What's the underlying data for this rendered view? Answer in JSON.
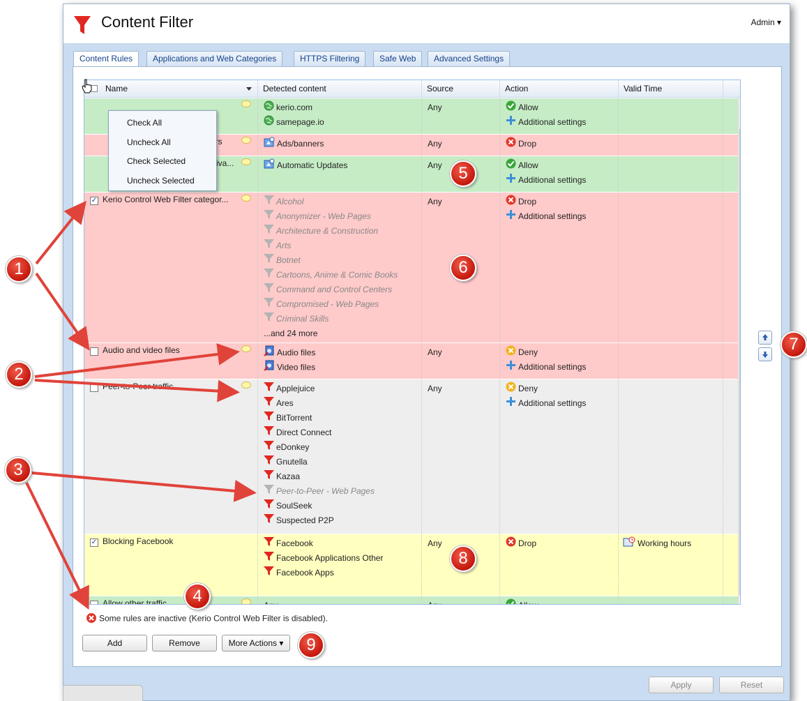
{
  "window": {
    "title": "Content Filter",
    "user_menu": "Admin ▾",
    "brand_color": "#e02820"
  },
  "tabs": [
    {
      "label": "Content Rules",
      "active": true
    },
    {
      "label": "Applications and Web Categories",
      "active": false
    },
    {
      "label": "HTTPS Filtering",
      "active": false
    },
    {
      "label": "Safe Web",
      "active": false
    },
    {
      "label": "Advanced Settings",
      "active": false
    }
  ],
  "grid": {
    "columns": [
      "Name",
      "Detected content",
      "Source",
      "Action",
      "Valid Time"
    ],
    "header_menu": [
      "Check All",
      "Uncheck All",
      "Check Selected",
      "Uncheck Selected"
    ],
    "rows": [
      {
        "name": "",
        "checked": false,
        "color": "green",
        "detected": [
          {
            "text": "kerio.com",
            "icon": "globe-icon"
          },
          {
            "text": "samepage.io",
            "icon": "globe-icon"
          }
        ],
        "source": "Any",
        "action": [
          {
            "text": "Allow",
            "icon": "allow-icon"
          },
          {
            "text": "Additional settings",
            "icon": "plus-icon"
          }
        ],
        "valid_time": ""
      },
      {
        "name": "ers",
        "checked": false,
        "color": "red",
        "detected": [
          {
            "text": "Ads/banners",
            "icon": "app-category-icon"
          }
        ],
        "source": "Any",
        "action": [
          {
            "text": "Drop",
            "icon": "drop-icon"
          }
        ],
        "valid_time": ""
      },
      {
        "name": "activa...",
        "checked": false,
        "color": "green",
        "detected": [
          {
            "text": "Automatic Updates",
            "icon": "app-category-icon"
          }
        ],
        "source": "Any",
        "action": [
          {
            "text": "Allow",
            "icon": "allow-icon"
          },
          {
            "text": "Additional settings",
            "icon": "plus-icon"
          }
        ],
        "valid_time": ""
      },
      {
        "name": "Kerio Control Web Filter categor...",
        "checked": true,
        "color": "red",
        "detected": [
          {
            "text": "Alcohol",
            "icon": "filter-gray-icon",
            "inactive": true
          },
          {
            "text": "Anonymizer - Web Pages",
            "icon": "filter-gray-icon",
            "inactive": true
          },
          {
            "text": "Architecture & Construction",
            "icon": "filter-gray-icon",
            "inactive": true
          },
          {
            "text": "Arts",
            "icon": "filter-gray-icon",
            "inactive": true
          },
          {
            "text": "Botnet",
            "icon": "filter-gray-icon",
            "inactive": true
          },
          {
            "text": "Cartoons, Anime & Comic Books",
            "icon": "filter-gray-icon",
            "inactive": true
          },
          {
            "text": "Command and Control Centers",
            "icon": "filter-gray-icon",
            "inactive": true
          },
          {
            "text": "Compromised - Web Pages",
            "icon": "filter-gray-icon",
            "inactive": true
          },
          {
            "text": "Criminal Skills",
            "icon": "filter-gray-icon",
            "inactive": true
          },
          {
            "text": "...and 24 more",
            "icon": "",
            "inactive": false
          }
        ],
        "source": "Any",
        "action": [
          {
            "text": "Drop",
            "icon": "drop-icon"
          },
          {
            "text": "Additional settings",
            "icon": "plus-icon"
          }
        ],
        "valid_time": ""
      },
      {
        "name": "Audio and video files",
        "checked": false,
        "color": "red",
        "detected": [
          {
            "text": "Audio files",
            "icon": "file-type-icon"
          },
          {
            "text": "Video files",
            "icon": "file-type-icon"
          }
        ],
        "source": "Any",
        "action": [
          {
            "text": "Deny",
            "icon": "deny-icon"
          },
          {
            "text": "Additional settings",
            "icon": "plus-icon"
          }
        ],
        "valid_time": ""
      },
      {
        "name": "Peer-to-Peer traffic",
        "checked": false,
        "color": "gray",
        "detected": [
          {
            "text": "Applejuice",
            "icon": "filter-red-icon"
          },
          {
            "text": "Ares",
            "icon": "filter-red-icon"
          },
          {
            "text": "BitTorrent",
            "icon": "filter-red-icon"
          },
          {
            "text": "Direct Connect",
            "icon": "filter-red-icon"
          },
          {
            "text": "eDonkey",
            "icon": "filter-red-icon"
          },
          {
            "text": "Gnutella",
            "icon": "filter-red-icon"
          },
          {
            "text": "Kazaa",
            "icon": "filter-red-icon"
          },
          {
            "text": "Peer-to-Peer - Web Pages",
            "icon": "filter-gray-icon",
            "inactive": true
          },
          {
            "text": "SoulSeek",
            "icon": "filter-red-icon"
          },
          {
            "text": "Suspected P2P",
            "icon": "filter-red-icon"
          }
        ],
        "source": "Any",
        "action": [
          {
            "text": "Deny",
            "icon": "deny-icon"
          },
          {
            "text": "Additional settings",
            "icon": "plus-icon"
          }
        ],
        "valid_time": ""
      },
      {
        "name": "Blocking Facebook",
        "checked": true,
        "color": "yellow",
        "detected": [
          {
            "text": "Facebook",
            "icon": "filter-red-icon"
          },
          {
            "text": "Facebook Applications Other",
            "icon": "filter-red-icon"
          },
          {
            "text": "Facebook Apps",
            "icon": "filter-red-icon"
          }
        ],
        "source": "Any",
        "action": [
          {
            "text": "Drop",
            "icon": "drop-icon"
          }
        ],
        "valid_time": "Working hours"
      },
      {
        "name": "Allow other traffic",
        "checked": false,
        "color": "green",
        "detected": [
          {
            "text": "Any",
            "icon": ""
          }
        ],
        "source": "Any",
        "action": [
          {
            "text": "Allow",
            "icon": "allow-icon"
          }
        ],
        "valid_time": ""
      }
    ]
  },
  "status_message": "Some rules are inactive (Kerio Control Web Filter is disabled).",
  "buttons": {
    "add": "Add",
    "remove": "Remove",
    "more_actions": "More Actions ▾",
    "apply": "Apply",
    "reset": "Reset"
  },
  "callouts": [
    "1",
    "2",
    "3",
    "4",
    "5",
    "6",
    "7",
    "8",
    "9"
  ]
}
